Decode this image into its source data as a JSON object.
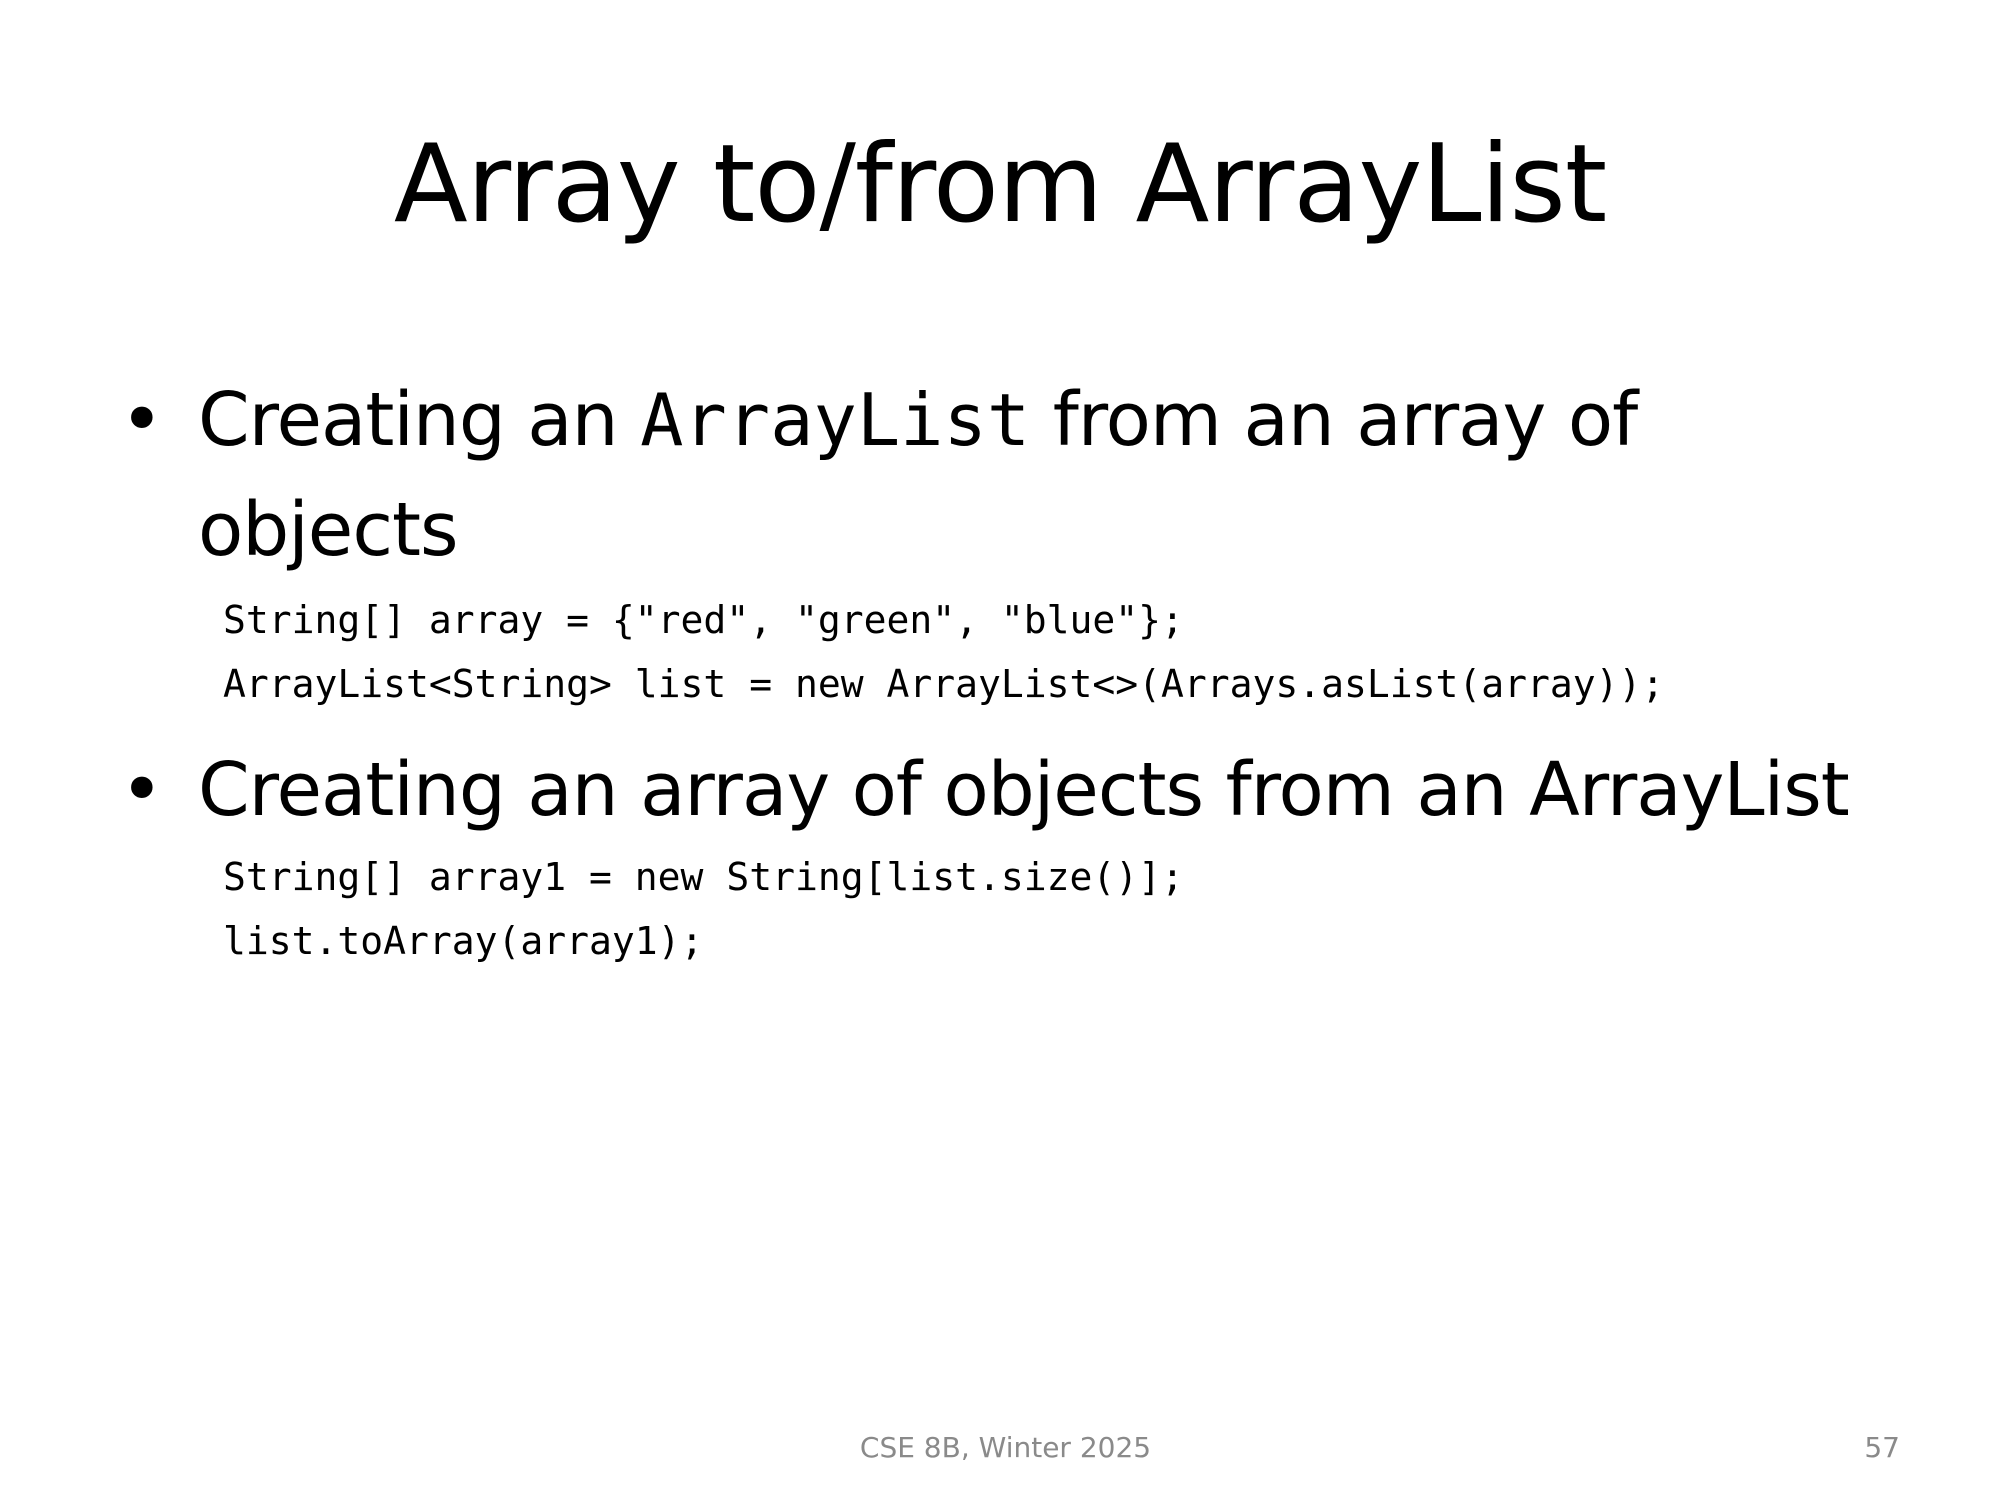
{
  "slide": {
    "title": "Array to/from ArrayList",
    "bullets": [
      {
        "marker": "•",
        "text_before": "Creating an ",
        "code_inline": "ArrayList",
        "text_after": " from an array of objects",
        "code_lines": [
          "String[] array = {\"red\", \"green\", \"blue\"};",
          "ArrayList<String> list = new ArrayList<>(Arrays.asList(array));"
        ]
      },
      {
        "marker": "•",
        "text": "Creating an array of objects from an ArrayList",
        "code_lines": [
          "String[] array1 = new String[list.size()];",
          "list.toArray(array1);"
        ]
      }
    ],
    "footer": {
      "course": "CSE 8B, Winter 2025",
      "page_number": "57"
    }
  }
}
